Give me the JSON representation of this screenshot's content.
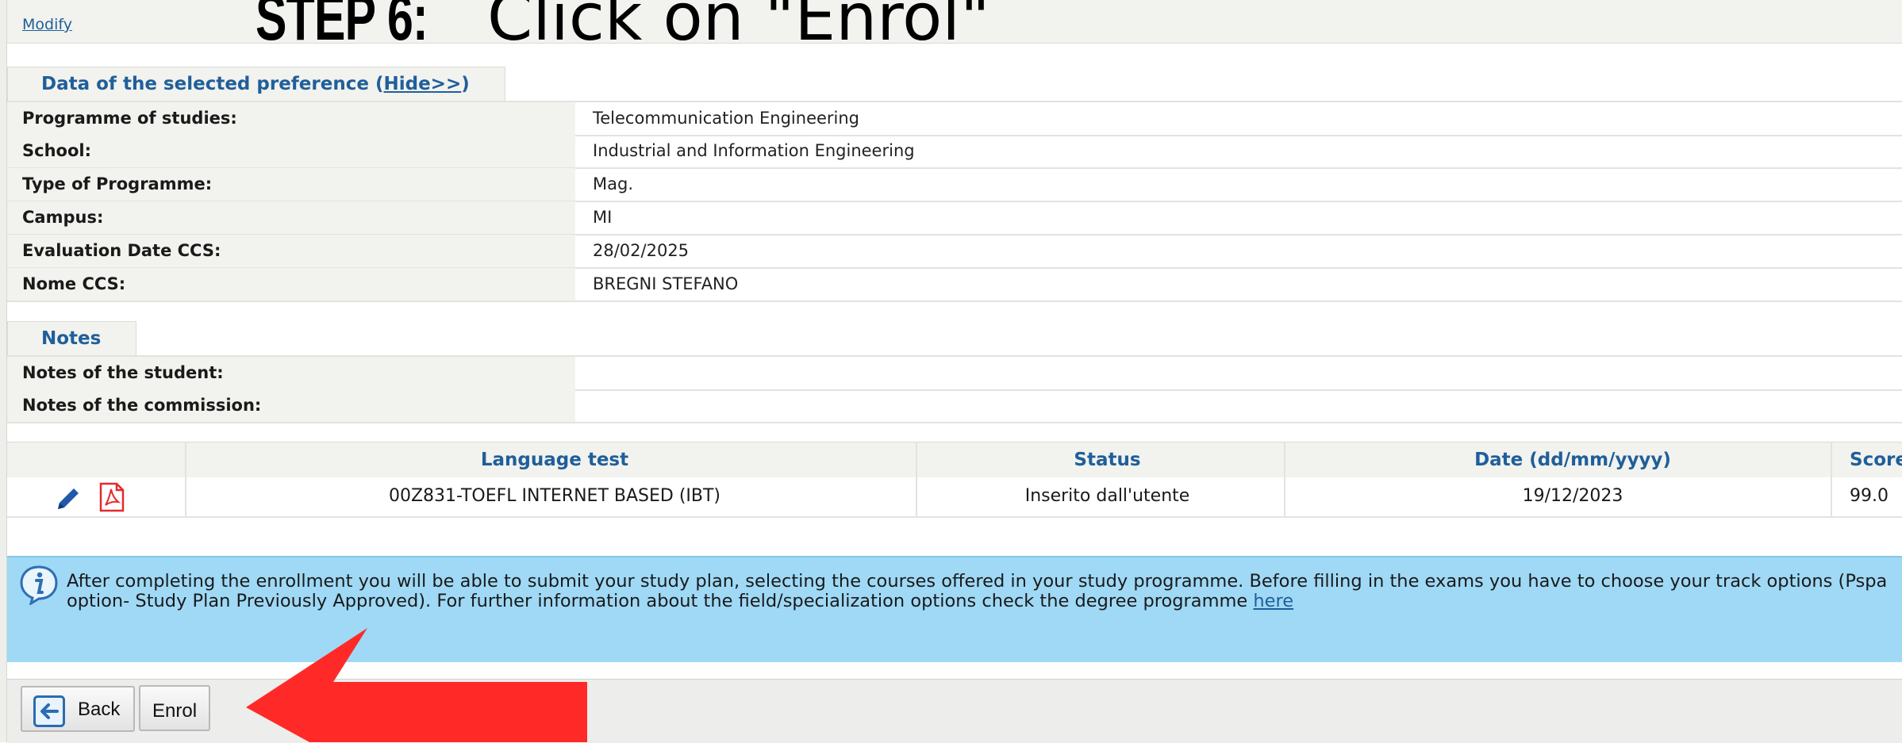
{
  "top": {
    "modify_label": "Modify"
  },
  "step_title": {
    "bold": "STEP 6:",
    "rest": " Click on \"Enrol\""
  },
  "preference": {
    "title_prefix": "Data of the selected preference (",
    "toggle_link": "Hide>>",
    "title_suffix": ")",
    "rows": [
      {
        "label": "Programme of studies:",
        "value": "Telecommunication Engineering"
      },
      {
        "label": "School:",
        "value": "Industrial and Information Engineering"
      },
      {
        "label": "Type of Programme:",
        "value": "Mag."
      },
      {
        "label": "Campus:",
        "value": "MI"
      },
      {
        "label": "Evaluation Date CCS:",
        "value": "28/02/2025"
      },
      {
        "label": "Nome CCS:",
        "value": "BREGNI STEFANO"
      }
    ]
  },
  "notes": {
    "title": "Notes",
    "rows": [
      {
        "label": "Notes of the student:",
        "value": ""
      },
      {
        "label": "Notes of the commission:",
        "value": ""
      }
    ]
  },
  "language_table": {
    "headers": {
      "test": "Language test",
      "status": "Status",
      "date": "Date (dd/mm/yyyy)",
      "score": "Score"
    },
    "row": {
      "test": "00Z831-TOEFL INTERNET BASED (IBT)",
      "status": "Inserito dall'utente",
      "date": "19/12/2023",
      "score": "99.0"
    },
    "icons": [
      "pencil-icon",
      "pdf-icon"
    ]
  },
  "info": {
    "text": "After completing the enrollment you will be able to submit your study plan, selecting the courses offered in your study programme. Before filling in the exams you have to choose your track options (Pspa option- Study Plan Previously Approved). For further information about the field/specialization options check the degree programme ",
    "link": "here"
  },
  "buttons": {
    "back": "Back",
    "enrol": "Enrol"
  },
  "colors": {
    "header_text": "#1f5f9a",
    "info_bg": "#9fd9f6",
    "arrow": "#ff2a27"
  }
}
